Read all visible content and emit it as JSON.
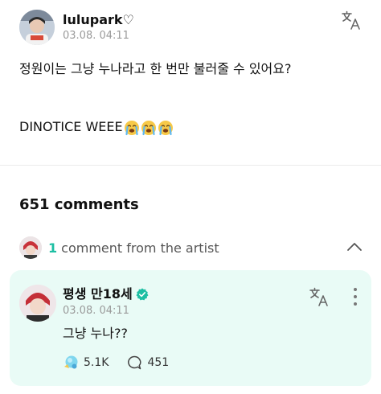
{
  "post": {
    "author": "lulupark♡",
    "timestamp": "03.08. 04:11",
    "line1": "정원이는 그냥 누나라고 한 번만 불러줄 수 있어요?",
    "line2_text": "DINOTICE WEEE",
    "line2_emojis": [
      "loudly-crying-face",
      "loudly-crying-face",
      "loudly-crying-face"
    ],
    "translate_icon": "translate-icon"
  },
  "comments": {
    "title": "651 comments",
    "artist_count": "1",
    "artist_label": "comment from the artist",
    "collapse_icon": "chevron-up-icon"
  },
  "artist_comment": {
    "author": "평생 만18세",
    "verified_icon": "verified-badge-icon",
    "timestamp": "03.08. 04:11",
    "text": "그냥 누나??",
    "likes": "5.1K",
    "replies": "451",
    "like_icon": "bubble-like-icon",
    "reply_icon": "comment-bubble-icon",
    "more_icon": "more-vertical-icon",
    "translate_icon": "translate-icon"
  },
  "colors": {
    "accent": "#1dbfa3",
    "card_background": "#e9fbf6",
    "meta_text": "#9a9a9a"
  }
}
